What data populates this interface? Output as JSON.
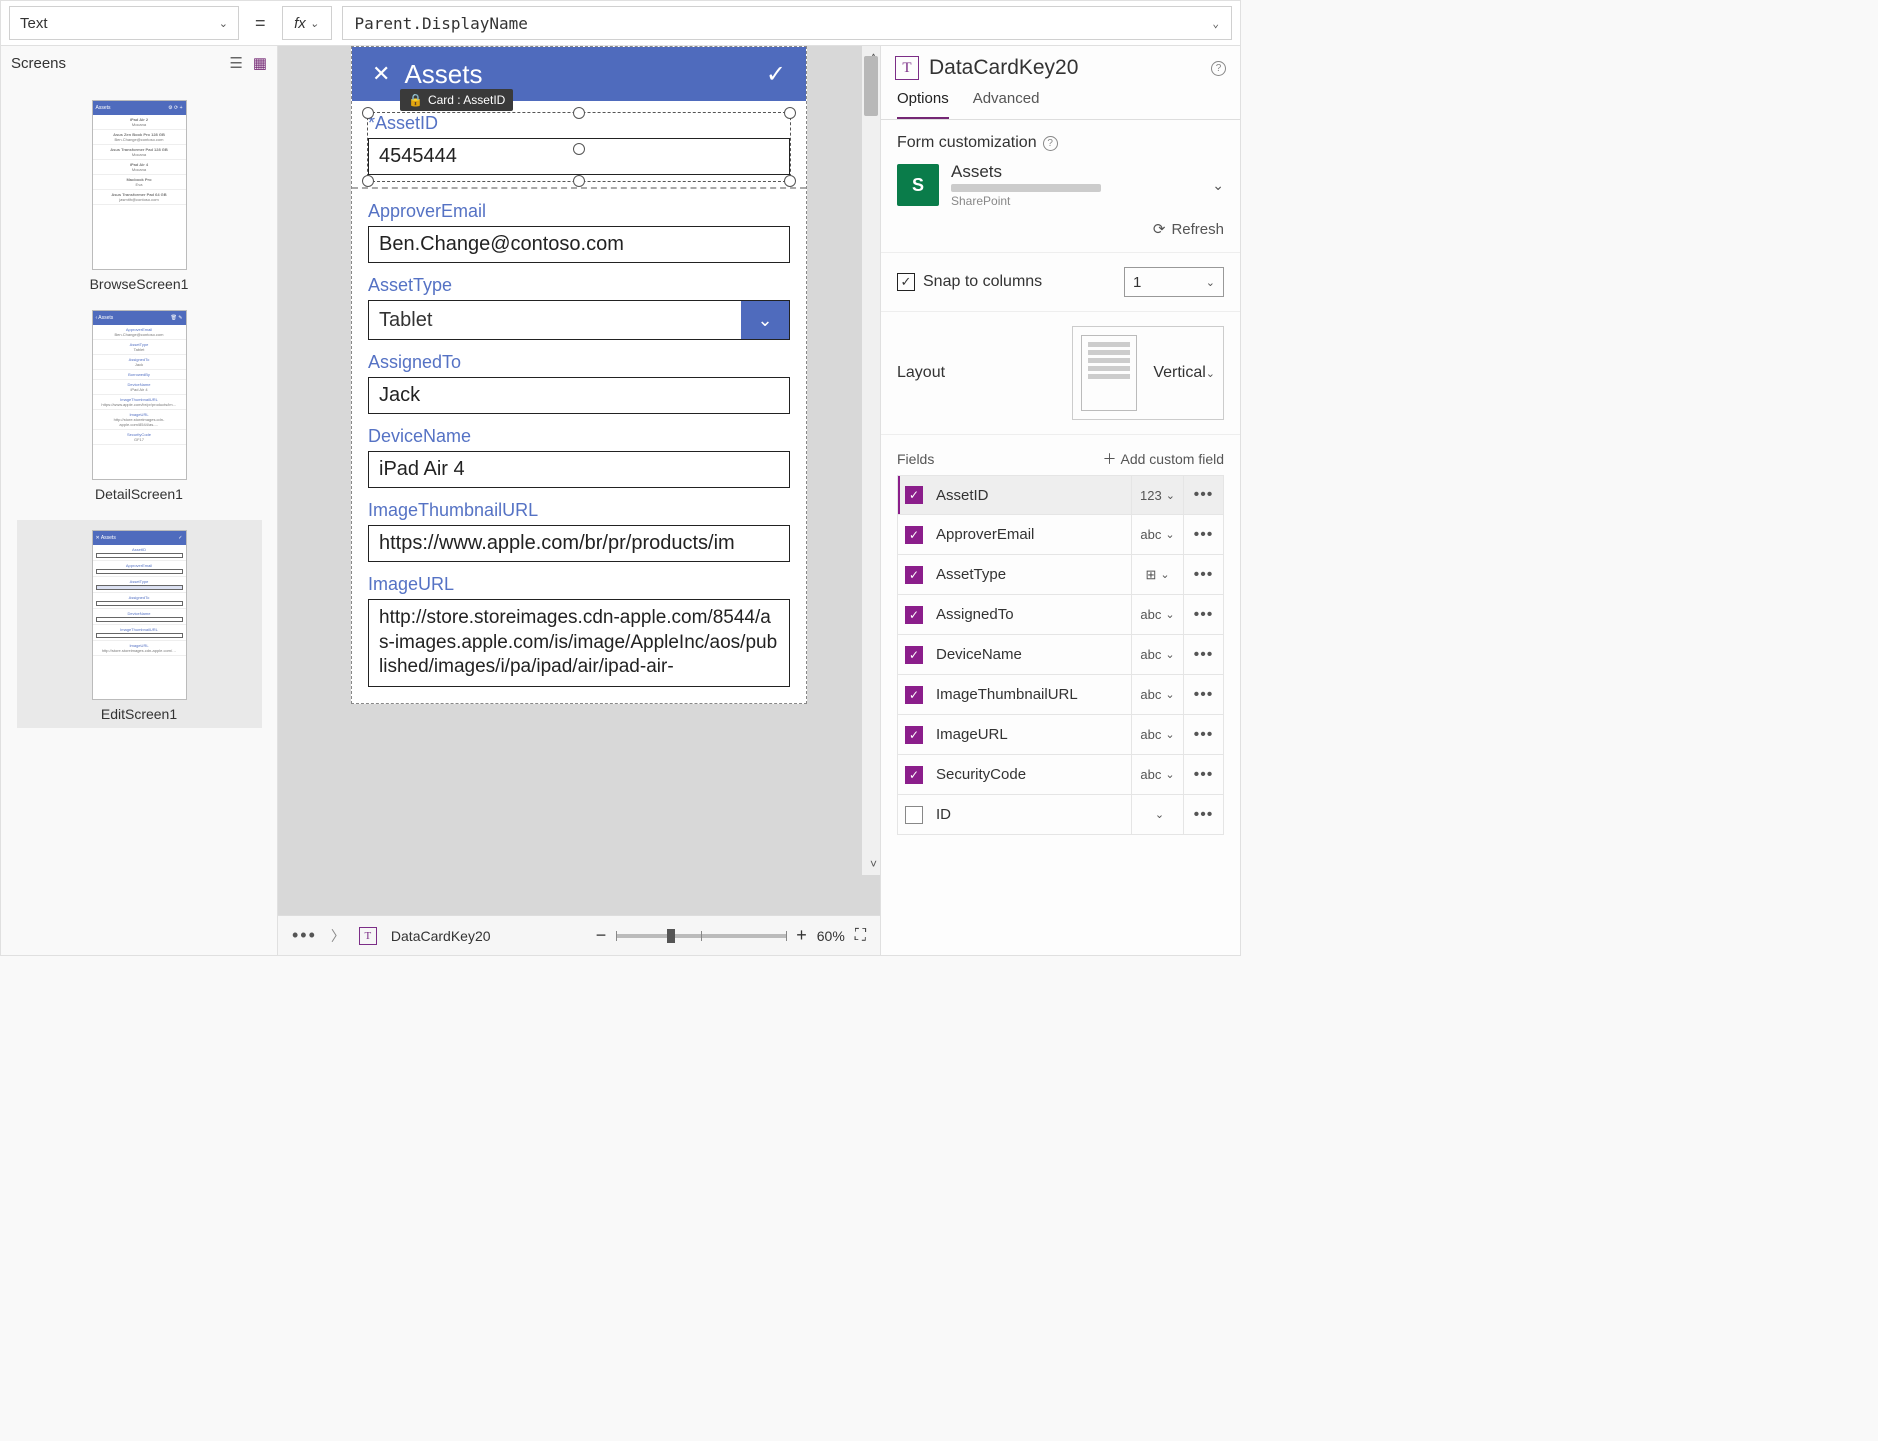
{
  "formula_bar": {
    "property": "Text",
    "formula": "Parent.DisplayName"
  },
  "screens_panel": {
    "title": "Screens",
    "thumbs": [
      {
        "name": "BrowseScreen1",
        "title": "Assets"
      },
      {
        "name": "DetailScreen1",
        "title": "Assets"
      },
      {
        "name": "EditScreen1",
        "title": "Assets"
      }
    ]
  },
  "canvas": {
    "app_title": "Assets",
    "selected_card_tooltip": "Card : AssetID",
    "fields": {
      "assetid": {
        "label": "AssetID",
        "value": "4545444",
        "required": true
      },
      "approver": {
        "label": "ApproverEmail",
        "value": "Ben.Change@contoso.com"
      },
      "assettype": {
        "label": "AssetType",
        "value": "Tablet"
      },
      "assigned": {
        "label": "AssignedTo",
        "value": "Jack"
      },
      "device": {
        "label": "DeviceName",
        "value": "iPad Air 4"
      },
      "thumburl": {
        "label": "ImageThumbnailURL",
        "value": "https://www.apple.com/br/pr/products/im"
      },
      "imgurl": {
        "label": "ImageURL",
        "value": "http://store.storeimages.cdn-apple.com/8544/as-images.apple.com/is/image/AppleInc/aos/published/images/i/pa/ipad/air/ipad-air-"
      }
    }
  },
  "footer": {
    "breadcrumb": "DataCardKey20",
    "zoom": "60%"
  },
  "right_panel": {
    "title": "DataCardKey20",
    "tabs": {
      "options": "Options",
      "advanced": "Advanced"
    },
    "form_customization_label": "Form customization",
    "datasource": {
      "name": "Assets",
      "type": "SharePoint"
    },
    "refresh_label": "Refresh",
    "snap_label": "Snap to columns",
    "snap_columns": "1",
    "layout_label": "Layout",
    "layout_value": "Vertical",
    "fields_label": "Fields",
    "add_field_label": "Add custom field",
    "fields": [
      {
        "name": "AssetID",
        "type": "123",
        "checked": true,
        "selected": true
      },
      {
        "name": "ApproverEmail",
        "type": "abc",
        "checked": true
      },
      {
        "name": "AssetType",
        "type": "⊞",
        "checked": true
      },
      {
        "name": "AssignedTo",
        "type": "abc",
        "checked": true
      },
      {
        "name": "DeviceName",
        "type": "abc",
        "checked": true
      },
      {
        "name": "ImageThumbnailURL",
        "type": "abc",
        "checked": true
      },
      {
        "name": "ImageURL",
        "type": "abc",
        "checked": true
      },
      {
        "name": "SecurityCode",
        "type": "abc",
        "checked": true
      },
      {
        "name": "ID",
        "type": "",
        "checked": false
      }
    ]
  }
}
